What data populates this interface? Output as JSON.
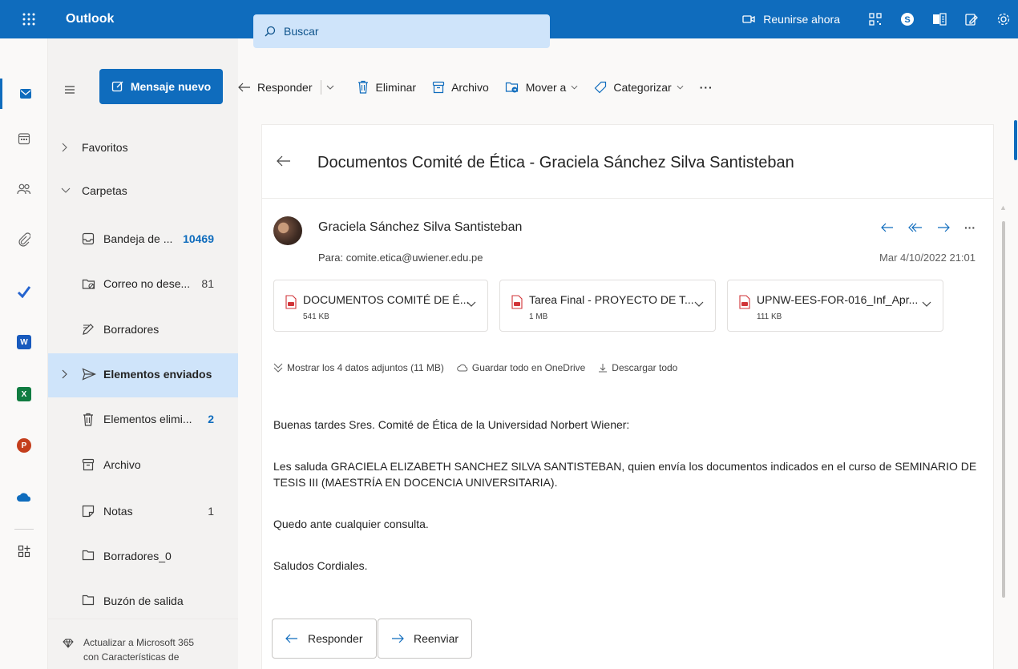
{
  "app": {
    "name": "Outlook"
  },
  "search": {
    "label": "Buscar"
  },
  "topbar": {
    "meet_label": "Reunirse ahora"
  },
  "toolbar": {
    "new_message": "Mensaje nuevo",
    "reply": "Responder",
    "delete": "Eliminar",
    "archive": "Archivo",
    "move_to": "Mover a",
    "categorize": "Categorizar",
    "more": "···"
  },
  "folders": {
    "favorites": "Favoritos",
    "folders_header": "Carpetas",
    "items": [
      {
        "label": "Bandeja de ...",
        "count": "10469"
      },
      {
        "label": "Correo no dese...",
        "count": "81"
      },
      {
        "label": "Borradores",
        "count": ""
      },
      {
        "label": "Elementos enviados",
        "count": ""
      },
      {
        "label": "Elementos elimi...",
        "count": "2"
      },
      {
        "label": "Archivo",
        "count": ""
      },
      {
        "label": "Notas",
        "count": "1"
      },
      {
        "label": "Borradores_0",
        "count": ""
      },
      {
        "label": "Buzón de salida",
        "count": ""
      }
    ],
    "upsell_line1": "Actualizar a Microsoft 365",
    "upsell_line2": "con Características de"
  },
  "message": {
    "subject": "Documentos Comité de Ética - Graciela Sánchez Silva Santisteban",
    "sender": "Graciela Sánchez Silva Santisteban",
    "to_label": "Para:",
    "to": "comite.etica@uwiener.edu.pe",
    "date": "Mar 4/10/2022 21:01",
    "attachments": [
      {
        "name": "DOCUMENTOS COMITÉ DE É...",
        "size": "541 KB"
      },
      {
        "name": "Tarea Final - PROYECTO DE T...",
        "size": "1 MB"
      },
      {
        "name": "UPNW-EES-FOR-016_Inf_Apr...",
        "size": "111 KB"
      }
    ],
    "show_all": "Mostrar los 4 datos adjuntos (11 MB)",
    "save_onedrive": "Guardar todo en OneDrive",
    "download_all": "Descargar todo",
    "body": [
      "Buenas tardes Sres. Comité de Ética de la Universidad Norbert Wiener:",
      "Les saluda GRACIELA ELIZABETH SANCHEZ SILVA SANTISTEBAN, quien envía los documentos indicados en el curso de SEMINARIO DE TESIS III (MAESTRÍA EN DOCENCIA UNIVERSITARIA).",
      "Quedo ante cualquier consulta.",
      "Saludos Cordiales."
    ],
    "reply_btn": "Responder",
    "forward_btn": "Reenviar"
  },
  "colors": {
    "brand": "#0f6cbd",
    "selected": "#cfe4fa",
    "pane": "#f3f2f1"
  }
}
